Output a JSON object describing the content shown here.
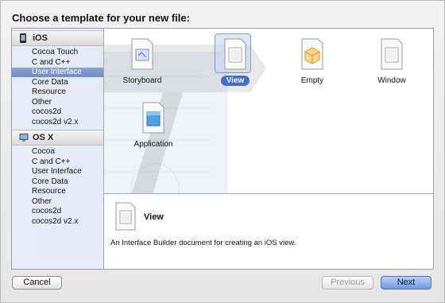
{
  "dialog": {
    "heading": "Choose a template for your new file:"
  },
  "sidebar": {
    "groups": [
      {
        "title": "iOS",
        "icon": "iphone-icon",
        "items": [
          "Cocoa Touch",
          "C and C++",
          "User Interface",
          "Core Data",
          "Resource",
          "Other",
          "cocos2d",
          "cocos2d v2.x"
        ],
        "selected": "User Interface"
      },
      {
        "title": "OS X",
        "icon": "mac-icon",
        "items": [
          "Cocoa",
          "C and C++",
          "User Interface",
          "Core Data",
          "Resource",
          "Other",
          "cocos2d",
          "cocos2d v2.x"
        ]
      }
    ]
  },
  "templates": [
    {
      "label": "Storyboard",
      "icon": "storyboard-icon"
    },
    {
      "label": "View",
      "icon": "view-icon",
      "selected": true
    },
    {
      "label": "Empty",
      "icon": "empty-icon"
    },
    {
      "label": "Window",
      "icon": "window-icon"
    },
    {
      "label": "Application",
      "icon": "application-icon"
    }
  ],
  "detail": {
    "title": "View",
    "description": "An Interface Builder document for creating an iOS view.",
    "icon": "view-icon"
  },
  "buttons": {
    "cancel": "Cancel",
    "previous": "Previous",
    "next": "Next"
  },
  "colors": {
    "selection": "#6f8cc0",
    "accent": "#3f6dcc",
    "default_button": "#6f9ae3"
  }
}
